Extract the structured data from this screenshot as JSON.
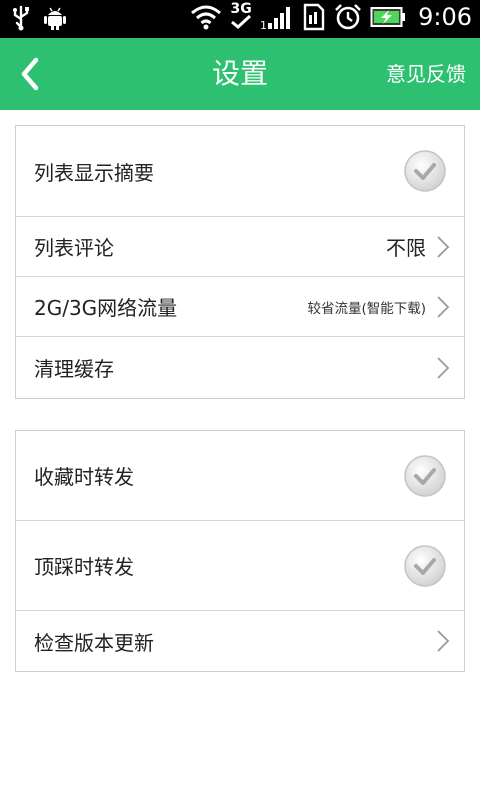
{
  "status_bar": {
    "network": "3G",
    "time": "9:06",
    "icons": [
      "usb-icon",
      "android-debug-icon",
      "wifi-icon",
      "3g-icon",
      "signal-icon",
      "sim-icon",
      "alarm-icon",
      "battery-charging-icon"
    ]
  },
  "header": {
    "title": "设置",
    "feedback_label": "意见反馈",
    "back_icon": "chevron-left-icon"
  },
  "colors": {
    "accent": "#2dc070",
    "status_bar": "#000000",
    "divider": "#d6d6d6"
  },
  "groups": [
    {
      "rows": [
        {
          "label": "列表显示摘要",
          "type": "toggle",
          "checked": true
        },
        {
          "label": "列表评论",
          "type": "select",
          "value": "不限"
        },
        {
          "label": "2G/3G网络流量",
          "type": "select",
          "value": "较省流量(智能下载)"
        },
        {
          "label": "清理缓存",
          "type": "link"
        }
      ]
    },
    {
      "rows": [
        {
          "label": "收藏时转发",
          "type": "toggle",
          "checked": true
        },
        {
          "label": "顶踩时转发",
          "type": "toggle",
          "checked": true
        },
        {
          "label": "检查版本更新",
          "type": "link"
        }
      ]
    }
  ]
}
